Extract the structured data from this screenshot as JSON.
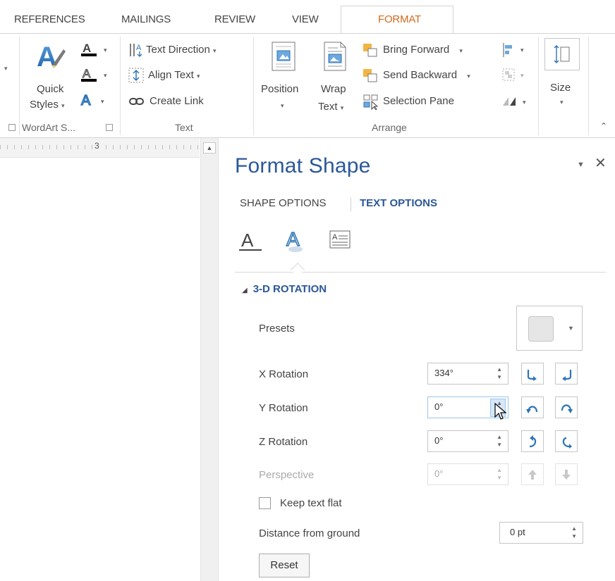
{
  "tabs": {
    "references": "REFERENCES",
    "mailings": "MAILINGS",
    "review": "REVIEW",
    "view": "VIEW",
    "format": "FORMAT"
  },
  "ribbon": {
    "wordart": {
      "quick_styles_line1": "Quick",
      "quick_styles_line2": "Styles",
      "group_label": "WordArt S..."
    },
    "text": {
      "text_direction": "Text Direction",
      "align_text": "Align Text",
      "create_link": "Create Link",
      "group_label": "Text"
    },
    "arrange": {
      "position": "Position",
      "wrap_line1": "Wrap",
      "wrap_line2": "Text",
      "bring_forward": "Bring Forward",
      "send_backward": "Send Backward",
      "selection_pane": "Selection Pane",
      "group_label": "Arrange"
    },
    "size": {
      "label": "Size"
    }
  },
  "ruler": {
    "number": "3"
  },
  "pane": {
    "title": "Format Shape",
    "tabs": {
      "shape_options": "SHAPE OPTIONS",
      "text_options": "TEXT OPTIONS"
    },
    "section_title": "3-D ROTATION",
    "presets_label": "Presets",
    "x_rotation": {
      "label": "X Rotation",
      "value": "334°"
    },
    "y_rotation": {
      "label": "Y Rotation",
      "value": "0°"
    },
    "z_rotation": {
      "label": "Z Rotation",
      "value": "0°"
    },
    "perspective": {
      "label": "Perspective",
      "value": "0°"
    },
    "keep_text_flat": "Keep text flat",
    "distance": {
      "label": "Distance from ground",
      "value": "0 pt"
    },
    "reset": "Reset"
  },
  "colors": {
    "accent": "#2b579a",
    "format_tab": "#d2691e",
    "icon_blue": "#2e75b6"
  }
}
